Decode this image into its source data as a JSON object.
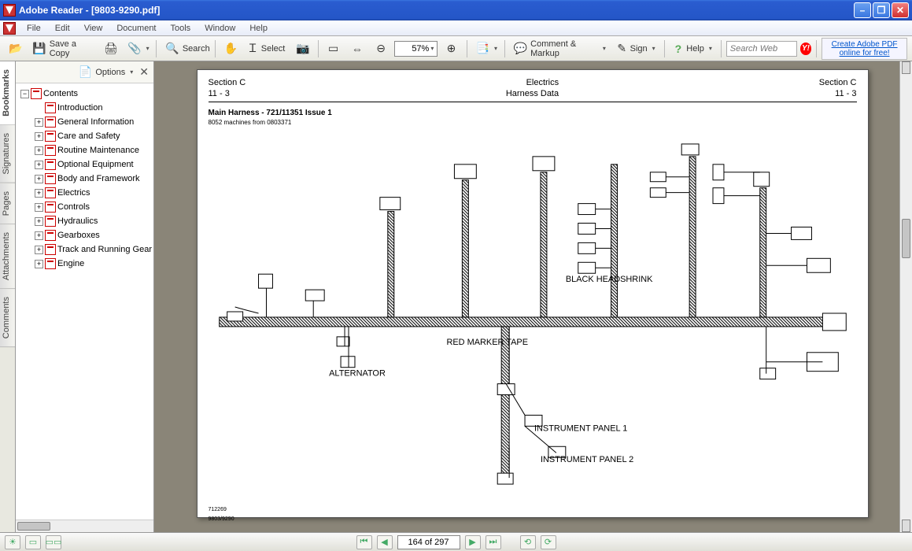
{
  "window": {
    "title": "Adobe Reader - [9803-9290.pdf]"
  },
  "menu": [
    "File",
    "Edit",
    "View",
    "Document",
    "Tools",
    "Window",
    "Help"
  ],
  "toolbar": {
    "save": "Save a Copy",
    "search": "Search",
    "select": "Select",
    "zoom": "57%",
    "comment": "Comment & Markup",
    "sign": "Sign",
    "help": "Help",
    "searchweb_ph": "Search Web",
    "createpdf": "Create Adobe PDF online for free!"
  },
  "sidetabs": [
    "Bookmarks",
    "Signatures",
    "Pages",
    "Attachments",
    "Comments"
  ],
  "bookmarks": {
    "options": "Options",
    "root": "Contents",
    "items": [
      {
        "label": "Introduction",
        "leaf": true
      },
      {
        "label": "General Information"
      },
      {
        "label": "Care and Safety"
      },
      {
        "label": "Routine Maintenance"
      },
      {
        "label": "Optional Equipment"
      },
      {
        "label": "Body and Framework"
      },
      {
        "label": "Electrics"
      },
      {
        "label": "Controls"
      },
      {
        "label": "Hydraulics"
      },
      {
        "label": "Gearboxes"
      },
      {
        "label": "Track and Running Gear"
      },
      {
        "label": "Engine"
      }
    ]
  },
  "doc": {
    "header": {
      "left_top": "Section C",
      "left_sub": "11 - 3",
      "mid_top": "Electrics",
      "mid_sub": "Harness Data",
      "right_top": "Section C",
      "right_sub": "11 - 3"
    },
    "title": "Main Harness - 721/11351 Issue 1",
    "subtitle": "8052 machines from 0803371",
    "footer_left": "712269",
    "footer_bot": "9803/9290"
  },
  "status": {
    "page": "164 of 297"
  }
}
